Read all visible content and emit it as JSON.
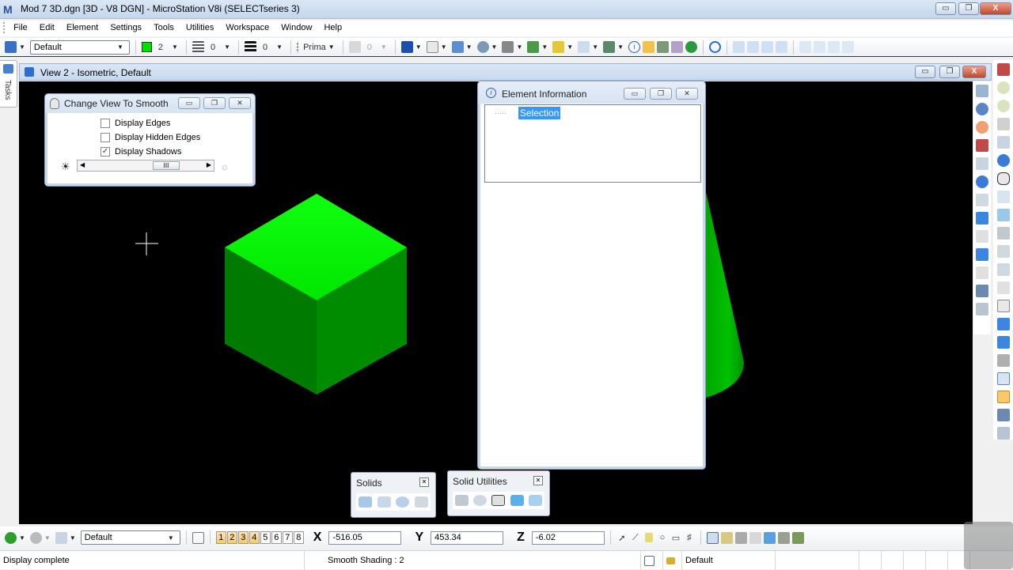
{
  "app": {
    "title": "Mod 7 3D.dgn [3D - V8 DGN] - MicroStation V8i (SELECTseries 3)",
    "window_buttons": {
      "minimize": "▭",
      "restore": "❐",
      "close": "X"
    }
  },
  "menu": [
    "File",
    "Edit",
    "Element",
    "Settings",
    "Tools",
    "Utilities",
    "Workspace",
    "Window",
    "Help"
  ],
  "toolbar": {
    "level_combo": "Default",
    "color_value": "2",
    "color_swatch": "#00e000",
    "style_value": "0",
    "weight_value": "0",
    "class_value": "Prima",
    "transparency_value": "0"
  },
  "tasks": {
    "label": "Tasks"
  },
  "view": {
    "title": "View 2 - Isometric, Default",
    "background": "#000000"
  },
  "smooth_dialog": {
    "title": "Change View To Smooth",
    "options": [
      {
        "label": "Display Edges",
        "checked": false
      },
      {
        "label": "Display Hidden Edges",
        "checked": false
      },
      {
        "label": "Display Shadows",
        "checked": true
      }
    ],
    "slider_thumb": "III",
    "dark_icon": "☀",
    "light_icon": "☼"
  },
  "element_info": {
    "title": "Element Information",
    "tree": [
      {
        "label": "Selection",
        "selected": true
      }
    ]
  },
  "solids_box": {
    "title": "Solids",
    "tools": [
      "slab-icon",
      "extrude-icon",
      "primitive-sphere-icon",
      "modify-solid-icon"
    ]
  },
  "solid_utilities_box": {
    "title": "Solid Utilities",
    "tools": [
      "boolean-icon",
      "shell-icon",
      "separate-icon",
      "thicken-icon",
      "slice-icon"
    ]
  },
  "bottom": {
    "view_combo": "Default",
    "view_numbers": [
      {
        "n": "1",
        "on": true
      },
      {
        "n": "2",
        "on": true
      },
      {
        "n": "3",
        "on": true
      },
      {
        "n": "4",
        "on": true
      },
      {
        "n": "5",
        "on": false
      },
      {
        "n": "6",
        "on": false
      },
      {
        "n": "7",
        "on": false
      },
      {
        "n": "8",
        "on": false
      }
    ],
    "x_label": "X",
    "x_value": "-516.05",
    "y_label": "Y",
    "y_value": "453.34",
    "z_label": "Z",
    "z_value": "-6.02"
  },
  "status": {
    "message": "Display complete",
    "prompt": "Smooth Shading : 2",
    "level": "Default"
  },
  "colors": {
    "green_bright": "#00ff00",
    "green_dark": "#008000",
    "selection": "#3399ff"
  }
}
